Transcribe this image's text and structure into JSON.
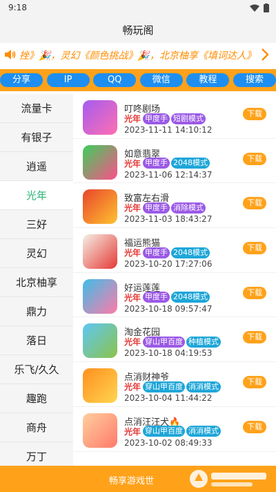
{
  "status": {
    "time": "9:18"
  },
  "app": {
    "title": "畅玩阁"
  },
  "marquee": {
    "text": "挫》🎉，灵幻《颜色挑战》🎉，北京柚享《填词达人》🎉"
  },
  "buttons": [
    {
      "label": "分享"
    },
    {
      "label": "IP"
    },
    {
      "label": "QQ"
    },
    {
      "label": "微信"
    },
    {
      "label": "教程"
    },
    {
      "label": "搜索"
    }
  ],
  "sidebar": [
    {
      "label": "流量卡"
    },
    {
      "label": "有银子"
    },
    {
      "label": "逍遥"
    },
    {
      "label": "光年",
      "active": true
    },
    {
      "label": "三好"
    },
    {
      "label": "灵幻"
    },
    {
      "label": "北京柚享"
    },
    {
      "label": "鼎力"
    },
    {
      "label": "落日"
    },
    {
      "label": "乐飞/久久"
    },
    {
      "label": "趣跑"
    },
    {
      "label": "商舟"
    },
    {
      "label": "万丁"
    }
  ],
  "games": [
    {
      "name": "叮咚剧场",
      "platform": "光年",
      "tags": [
        {
          "text": "甲度手",
          "color": "#9b59e6"
        },
        {
          "text": "短剧模式",
          "color": "#9b59e6"
        }
      ],
      "date": "2023-11-11 14:10:12",
      "thumb": [
        "#a45cf0",
        "#ff6fb0"
      ]
    },
    {
      "name": "如意翡翠",
      "platform": "光年",
      "tags": [
        {
          "text": "甲度手",
          "color": "#9b59e6"
        },
        {
          "text": "2048模式",
          "color": "#1ea6d8"
        }
      ],
      "date": "2023-11-06 12:14:37",
      "thumb": [
        "#3ccf5b",
        "#ff4f8a"
      ]
    },
    {
      "name": "致富左右滑",
      "platform": "光年",
      "tags": [
        {
          "text": "甲度手",
          "color": "#9b59e6"
        },
        {
          "text": "消除模式",
          "color": "#9b59e6"
        }
      ],
      "date": "2023-11-03 18:43:27",
      "thumb": [
        "#e8452c",
        "#ffc230"
      ]
    },
    {
      "name": "福运熊猫",
      "platform": "光年",
      "tags": [
        {
          "text": "甲度手",
          "color": "#9b59e6"
        },
        {
          "text": "2048模式",
          "color": "#1ea6d8"
        }
      ],
      "date": "2023-10-20 17:27:06",
      "thumb": [
        "#f5f0e6",
        "#e53935"
      ]
    },
    {
      "name": "好运莲莲",
      "platform": "光年",
      "tags": [
        {
          "text": "甲度手",
          "color": "#9b59e6"
        },
        {
          "text": "2048模式",
          "color": "#1ea6d8"
        }
      ],
      "date": "2023-10-18 09:57:47",
      "thumb": [
        "#3fbde9",
        "#ff7aa8"
      ]
    },
    {
      "name": "淘金花园",
      "platform": "光年",
      "tags": [
        {
          "text": "穿山甲百度",
          "color": "#9b59e6"
        },
        {
          "text": "种植模式",
          "color": "#1ea6d8"
        }
      ],
      "date": "2023-10-18 04:19:53",
      "thumb": [
        "#5fc7f5",
        "#8bc34a"
      ]
    },
    {
      "name": "点消财神爷",
      "platform": "光年",
      "tags": [
        {
          "text": "穿山甲百度",
          "color": "#1ea6d8"
        },
        {
          "text": "消消模式",
          "color": "#1ea6d8"
        }
      ],
      "date": "2023-10-04 11:44:22",
      "thumb": [
        "#ff8f1f",
        "#ffd54f"
      ]
    },
    {
      "name": "点消汪汪犬🔥",
      "platform": "光年",
      "tags": [
        {
          "text": "穿山甲百度",
          "color": "#1ea6d8"
        },
        {
          "text": "消消模式",
          "color": "#1ea6d8"
        }
      ],
      "date": "2023-10-02 08:49:33",
      "thumb": [
        "#ffcf9e",
        "#ff7a6a"
      ]
    }
  ],
  "download_label": "下载",
  "footer": {
    "text": "畅享游戏世"
  }
}
